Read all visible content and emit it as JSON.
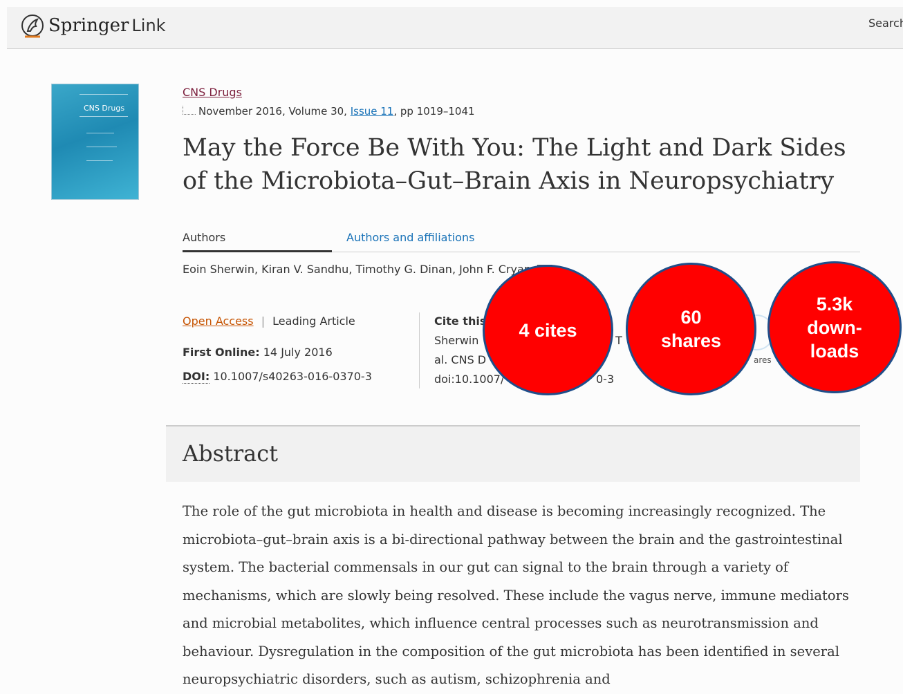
{
  "header": {
    "brand_springer": "Springer",
    "brand_link": "Link",
    "search_label": "Search"
  },
  "journal": {
    "name": "CNS Drugs",
    "cover_title": "CNS Drugs",
    "issue_prefix": "November 2016, Volume 30, ",
    "issue_link": "Issue 11",
    "issue_suffix": ", pp 1019–1041"
  },
  "article": {
    "title": "May the Force Be With You: The Light and Dark Sides of the Microbiota–Gut–Brain Axis in Neuropsychiatry",
    "tab_authors": "Authors",
    "tab_affiliations": "Authors and affiliations",
    "authors": "Eoin Sherwin, Kiran V. Sandhu, Timothy G. Dinan, John F. Cryan",
    "open_access": "Open Access",
    "separator": "|",
    "article_type": "Leading Article",
    "first_online_label": "First Online:",
    "first_online_value": " 14 July 2016",
    "doi_label": "DOI:",
    "doi_value": " 10.1007/s40263-016-0370-3"
  },
  "cite": {
    "title": "Cite this",
    "line1": "Sherwin",
    "frag1": ", T",
    "line2": "al. CNS D",
    "line3": "doi:10.1007/",
    "frag3": "0-3",
    "shares_fragment": "ares"
  },
  "badges": {
    "cites": "4 cites",
    "shares": "60\nshares",
    "downloads": "5.3k\ndown-\nloads",
    "color": "#ff0000",
    "border_color": "#1f4e8a"
  },
  "abstract": {
    "heading": "Abstract",
    "text": "The role of the gut microbiota in health and disease is becoming increasingly recognized. The microbiota–gut–brain axis is a bi-directional pathway between the brain and the gastrointestinal system. The bacterial commensals in our gut can signal to the brain through a variety of mechanisms, which are slowly being resolved. These include the vagus nerve, immune mediators and microbial metabolites, which influence central processes such as neurotransmission and behaviour. Dysregulation in the composition of the gut microbiota has been identified in several neuropsychiatric disorders, such as autism, schizophrenia and"
  }
}
